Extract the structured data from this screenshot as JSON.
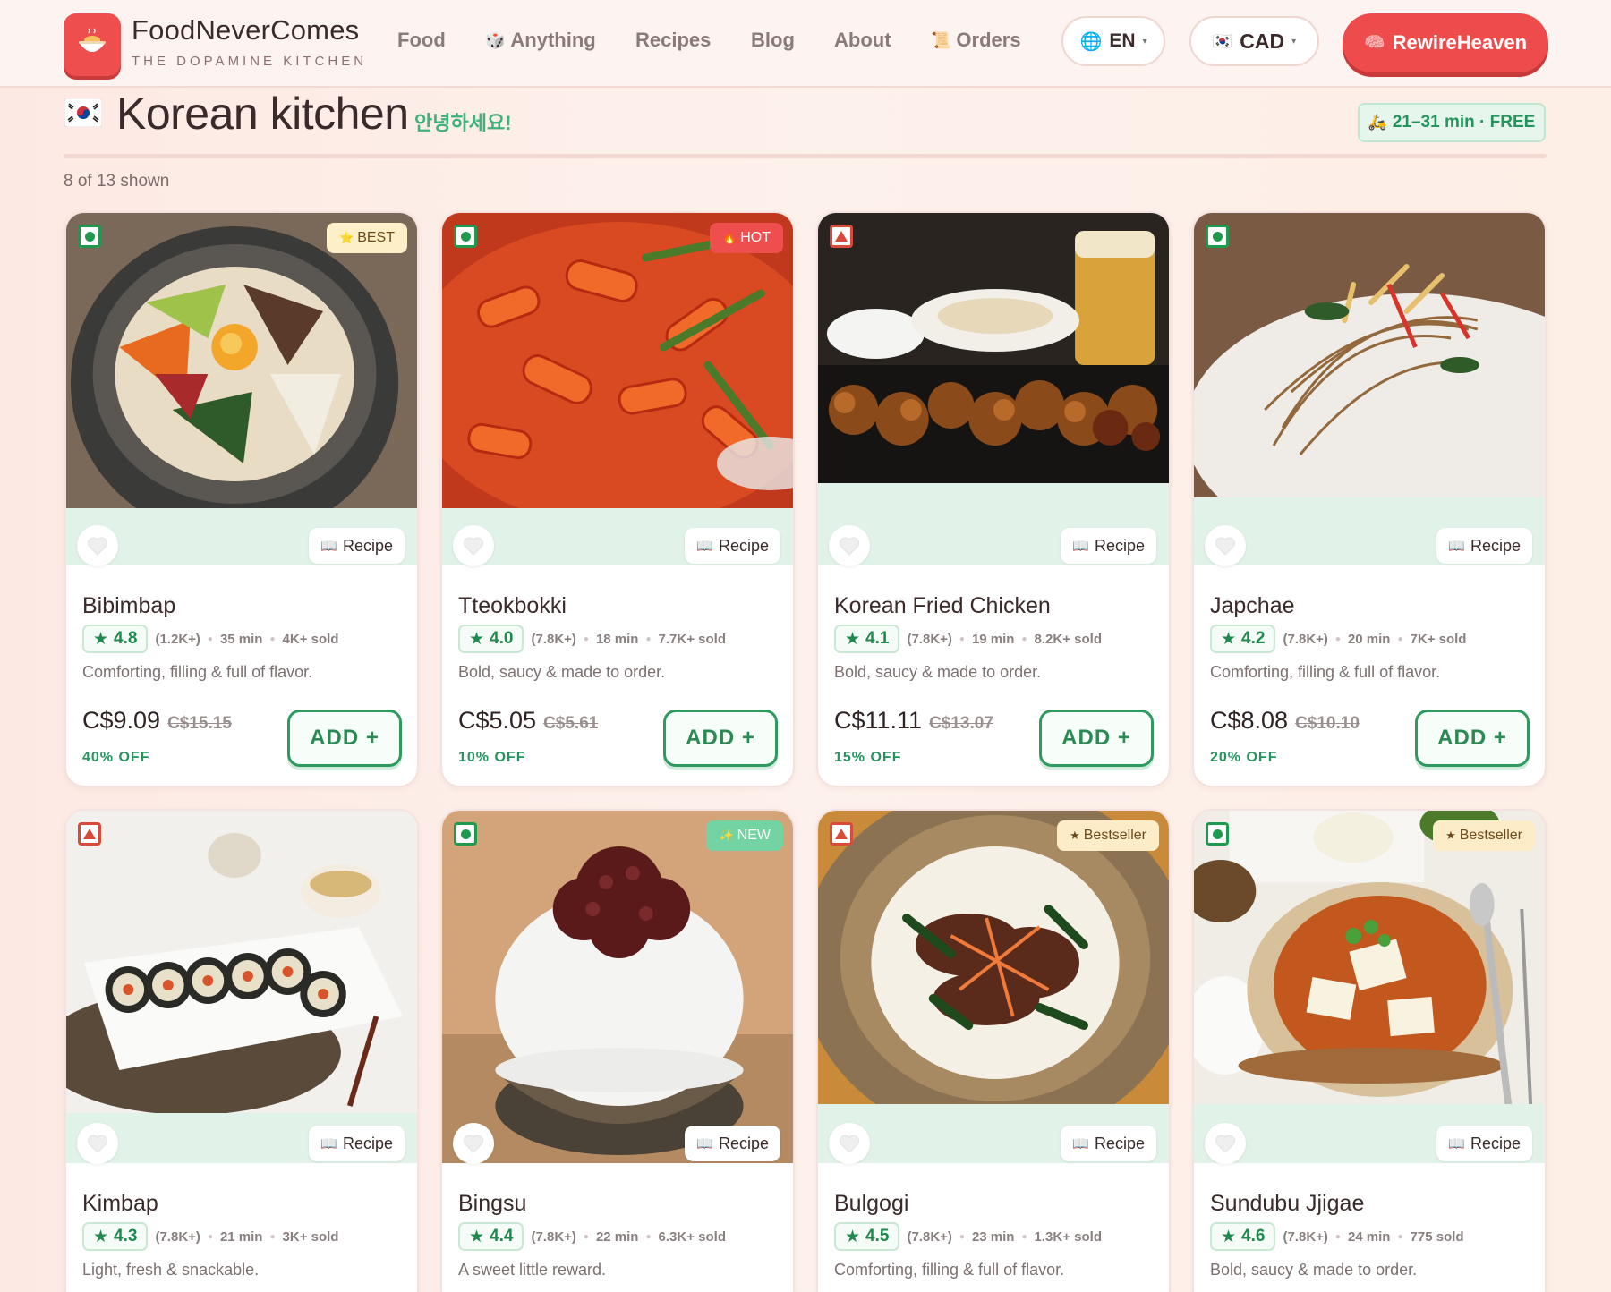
{
  "header": {
    "brand_name": "FoodNeverComes",
    "brand_tag": "THE DOPAMINE KITCHEN",
    "nav": [
      {
        "label": "Food",
        "icon": ""
      },
      {
        "label": "Anything",
        "icon": "dice-icon"
      },
      {
        "label": "Recipes",
        "icon": ""
      },
      {
        "label": "Blog",
        "icon": ""
      },
      {
        "label": "About",
        "icon": ""
      },
      {
        "label": "Orders",
        "icon": "scroll-icon"
      }
    ],
    "language": "EN",
    "currency": "CAD",
    "cta_label": "RewireHeaven"
  },
  "page": {
    "title": "Korean kitchen",
    "greeting": "안녕하세요!",
    "delivery": "21–31 min · FREE",
    "count_text": "8 of 13 shown"
  },
  "colors": {
    "accent_red": "#ee4c4c",
    "accent_green": "#2f9a5e",
    "strip_green": "#e1f3e8"
  },
  "labels": {
    "recipe": "Recipe",
    "add": "ADD +"
  },
  "items": [
    {
      "name": "Bibimbap",
      "rating": "4.8",
      "reviews": "(1.2K+)",
      "time": "35 min",
      "sold": "4K+ sold",
      "desc": "Comforting, filling & full of flavor.",
      "price": "C$9.09",
      "old_price": "C$15.15",
      "off": "40% OFF",
      "badge": "BEST",
      "badge_type": "best",
      "diet": "veg"
    },
    {
      "name": "Tteokbokki",
      "rating": "4.0",
      "reviews": "(7.8K+)",
      "time": "18 min",
      "sold": "7.7K+ sold",
      "desc": "Bold, saucy & made to order.",
      "price": "C$5.05",
      "old_price": "C$5.61",
      "off": "10% OFF",
      "badge": "HOT",
      "badge_type": "hot",
      "diet": "veg"
    },
    {
      "name": "Korean Fried Chicken",
      "rating": "4.1",
      "reviews": "(7.8K+)",
      "time": "19 min",
      "sold": "8.2K+ sold",
      "desc": "Bold, saucy & made to order.",
      "price": "C$11.11",
      "old_price": "C$13.07",
      "off": "15% OFF",
      "badge": "",
      "badge_type": "",
      "diet": "nonveg"
    },
    {
      "name": "Japchae",
      "rating": "4.2",
      "reviews": "(7.8K+)",
      "time": "20 min",
      "sold": "7K+ sold",
      "desc": "Comforting, filling & full of flavor.",
      "price": "C$8.08",
      "old_price": "C$10.10",
      "off": "20% OFF",
      "badge": "",
      "badge_type": "",
      "diet": "veg"
    },
    {
      "name": "Kimbap",
      "rating": "4.3",
      "reviews": "(7.8K+)",
      "time": "21 min",
      "sold": "3K+ sold",
      "desc": "Light, fresh & snackable.",
      "price": "",
      "old_price": "",
      "off": "",
      "badge": "",
      "badge_type": "",
      "diet": "nonveg"
    },
    {
      "name": "Bingsu",
      "rating": "4.4",
      "reviews": "(7.8K+)",
      "time": "22 min",
      "sold": "6.3K+ sold",
      "desc": "A sweet little reward.",
      "price": "",
      "old_price": "",
      "off": "",
      "badge": "NEW",
      "badge_type": "new",
      "diet": "veg"
    },
    {
      "name": "Bulgogi",
      "rating": "4.5",
      "reviews": "(7.8K+)",
      "time": "23 min",
      "sold": "1.3K+ sold",
      "desc": "Comforting, filling & full of flavor.",
      "price": "",
      "old_price": "",
      "off": "",
      "badge": "Bestseller",
      "badge_type": "seller",
      "diet": "nonveg"
    },
    {
      "name": "Sundubu Jjigae",
      "rating": "4.6",
      "reviews": "(7.8K+)",
      "time": "24 min",
      "sold": "775 sold",
      "desc": "Bold, saucy & made to order.",
      "price": "",
      "old_price": "",
      "off": "",
      "badge": "Bestseller",
      "badge_type": "seller",
      "diet": "veg"
    }
  ]
}
